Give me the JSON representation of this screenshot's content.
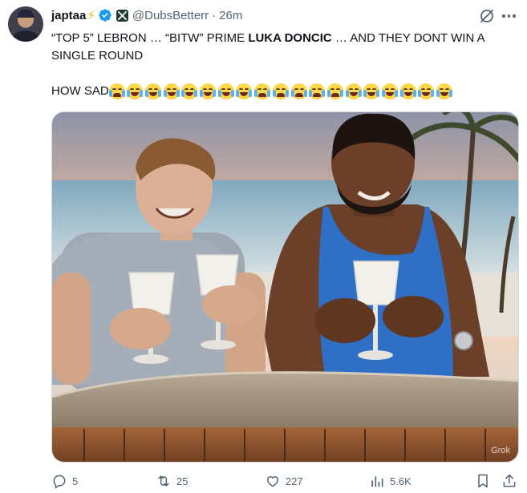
{
  "author": {
    "name": "japtaa",
    "badge_emoji": "⚡",
    "handle": "@DubsBetterr",
    "separator": "·",
    "time": "26m"
  },
  "icons": {
    "avatar": "avatar-icon",
    "verified": "verified-badge-icon",
    "affiliate": "x-affiliate-icon",
    "grok": "grok-icon",
    "more": "more-icon",
    "reply": "reply-icon",
    "repost": "repost-icon",
    "like": "like-icon",
    "views": "views-icon",
    "bookmark": "bookmark-icon",
    "share": "share-icon"
  },
  "text": {
    "part1": "“TOP 5” LEBRON … “BITW” PRIME ",
    "bold": "LUKA DONCIC",
    "part2": " … AND THEY DONT WIN A SINGLE ROUND",
    "line2": "HOW SAD",
    "emojis": [
      "cry",
      "laugh",
      "laugh",
      "laugh",
      "laugh",
      "laugh",
      "laugh",
      "laugh",
      "cry",
      "cry",
      "cry",
      "cry",
      "cry",
      "laugh",
      "laugh",
      "laugh",
      "laugh",
      "laugh",
      "laugh"
    ]
  },
  "media": {
    "watermark": "Grok"
  },
  "stats": {
    "replies": "5",
    "reposts": "25",
    "likes": "227",
    "views": "5.6K"
  },
  "colors": {
    "text": "#0f1419",
    "secondary": "#536471",
    "verified": "#1d9bf0",
    "bolt": "#f6b31a"
  }
}
